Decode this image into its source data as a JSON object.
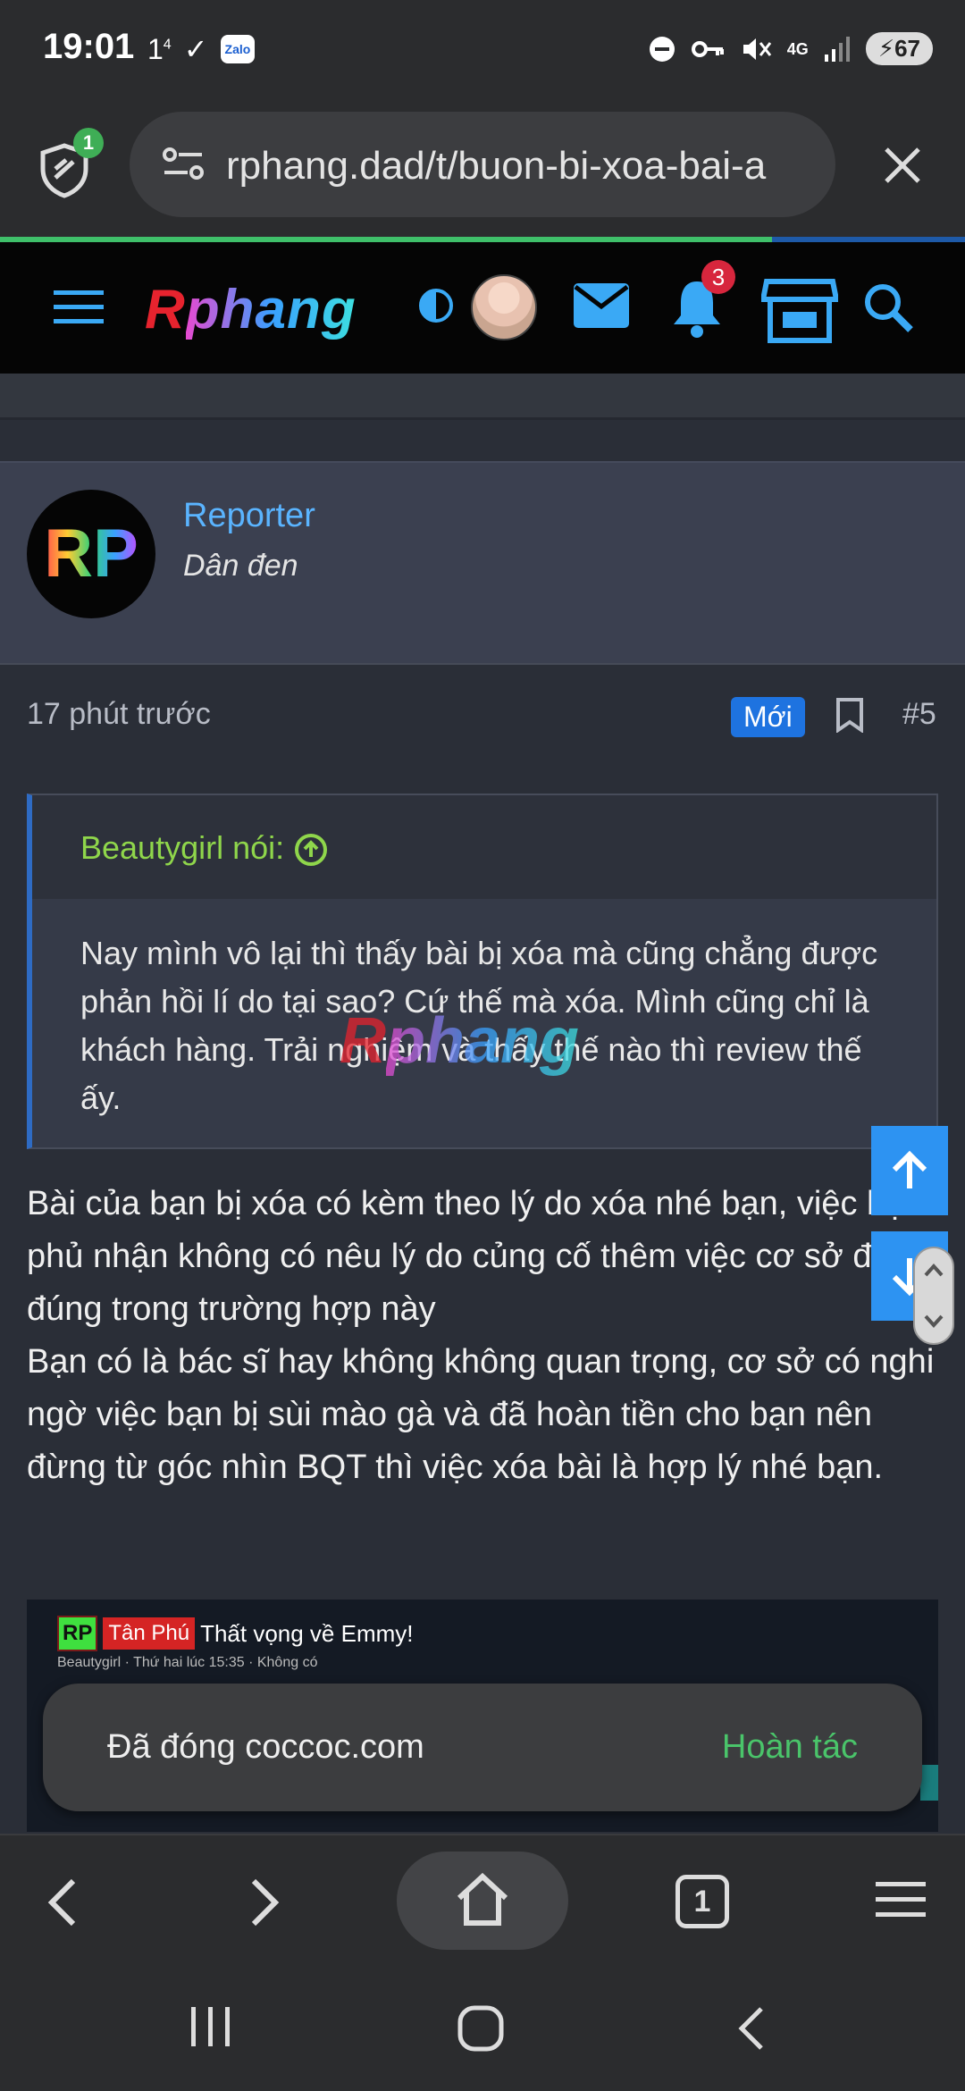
{
  "status_bar": {
    "time": "19:01",
    "notif_one": "1",
    "notif_one_sup": "4",
    "zalo_label": "Zalo",
    "network": "4G",
    "battery": "67"
  },
  "browser": {
    "url": "rphang.dad/t/buon-bi-xoa-bai-a",
    "shield_count": "1",
    "load_progress": 0.8,
    "tab_count": "1"
  },
  "site_nav": {
    "logo_r": "R",
    "logo_rest": "phang",
    "notification_count": "3"
  },
  "post": {
    "author_avatar_text": "RP",
    "author_name": "Reporter",
    "author_title": "Dân đen",
    "time_ago": "17 phút trước",
    "new_badge": "Mới",
    "post_number": "#5",
    "quote_author": "Beautygirl nói:",
    "quote_text": "Nay mình vô lại thì thấy bài bị xóa mà cũng chẳng được phản hồi lí do tại sao? Cứ thế mà xóa. Mình cũng chỉ là khách hàng. Trải nghiệm và thấy thế nào thì review thế ấy.",
    "watermark_r": "R",
    "watermark_rest": "phang",
    "body_p1": "Bài của bạn bị xóa có kèm theo lý do xóa nhé bạn, việc bạn phủ nhận không có nêu lý do củng cố thêm việc cơ sở đã nói đúng trong trường hợp này",
    "body_p2": "Bạn có là bác sĩ hay không không quan trọng, cơ sở có nghi ngờ việc bạn bị sùi mào gà và đã hoàn tiền cho bạn nên đừng từ góc nhìn BQT thì việc xóa bài là hợp lý nhé bạn."
  },
  "embed": {
    "tag_rp": "RP",
    "tag_prefix": "Tân Phú",
    "title": "Thất vọng về Emmy!",
    "meta": "Beautygirl · Thứ hai lúc 15:35 · Không có"
  },
  "toast": {
    "message": "Đã đóng coccoc.com",
    "action": "Hoàn tác"
  },
  "colors": {
    "accent_blue": "#2d93f2",
    "link_blue": "#5ab4ff",
    "quote_green": "#8fd64b",
    "toast_green": "#4ac46a"
  }
}
